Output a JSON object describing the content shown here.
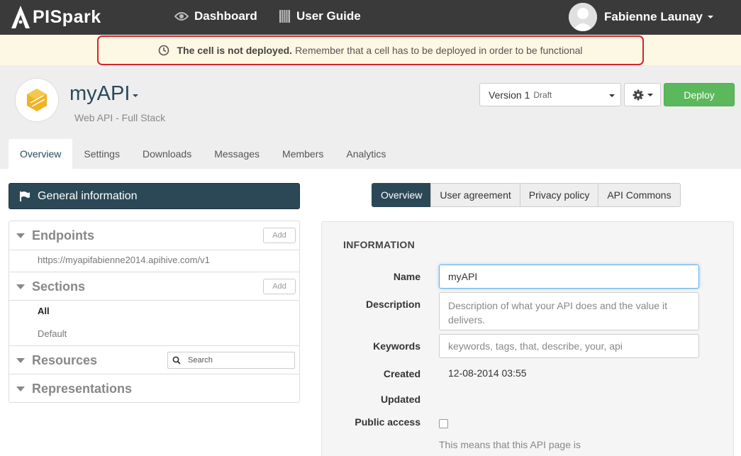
{
  "navbar": {
    "brand": "PISpark",
    "links": [
      {
        "label": "Dashboard",
        "icon": "eye-icon"
      },
      {
        "label": "User Guide",
        "icon": "book-icon"
      }
    ],
    "user_name": "Fabienne Launay"
  },
  "alert": {
    "strong": "The cell is not deployed.",
    "text": "Remember that a cell has to be deployed in order to be functional"
  },
  "header": {
    "api_name": "myAPI",
    "api_subtitle": "Web API - Full Stack",
    "version_label": "Version 1",
    "version_status": "Draft",
    "deploy_label": "Deploy"
  },
  "tabs": [
    {
      "label": "Overview",
      "active": true
    },
    {
      "label": "Settings"
    },
    {
      "label": "Downloads"
    },
    {
      "label": "Messages"
    },
    {
      "label": "Members"
    },
    {
      "label": "Analytics"
    }
  ],
  "sidebar": {
    "general_info": "General information",
    "endpoints": {
      "title": "Endpoints",
      "add": "Add",
      "items": [
        "https://myapifabienne2014.apihive.com/v1"
      ]
    },
    "sections": {
      "title": "Sections",
      "add": "Add",
      "items": [
        "All",
        "Default"
      ]
    },
    "resources": {
      "title": "Resources",
      "search_placeholder": "Search"
    },
    "representations": {
      "title": "Representations"
    }
  },
  "subtabs": [
    {
      "label": "Overview",
      "active": true
    },
    {
      "label": "User agreement"
    },
    {
      "label": "Privacy policy"
    },
    {
      "label": "API Commons"
    }
  ],
  "info": {
    "heading": "INFORMATION",
    "name_label": "Name",
    "name_value": "myAPI",
    "description_label": "Description",
    "description_placeholder": "Description of what your API does and the value it delivers.",
    "keywords_label": "Keywords",
    "keywords_placeholder": "keywords, tags, that, describe, your, api",
    "created_label": "Created",
    "created_value": "12-08-2014 03:55",
    "updated_label": "Updated",
    "public_label": "Public access",
    "public_checked": false,
    "public_help": "This means that this API page is"
  },
  "colors": {
    "navbar": "#3a3a3a",
    "primary": "#2c4857",
    "deploy": "#5cb85c",
    "alert_bg": "#fcf8e3",
    "alert_border": "#d9232d",
    "logo": "#f0b323"
  }
}
